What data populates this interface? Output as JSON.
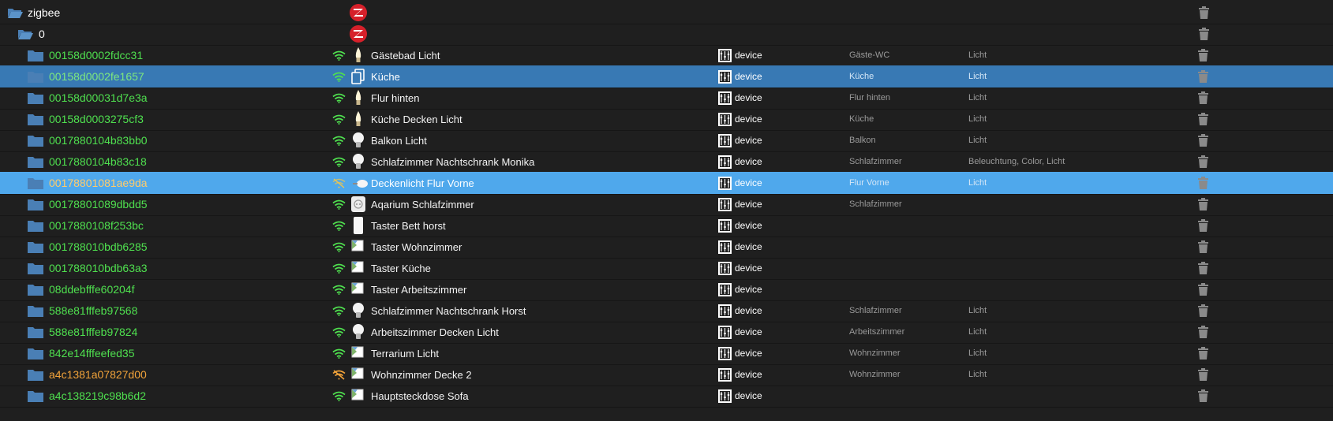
{
  "colors": {
    "background": "#1f1f1f",
    "selected_dark": "#3879b4",
    "selected_light": "#4fa8ec",
    "online": "#4fe04f",
    "offline": "#f2a33a",
    "folder": "#4a7fb5",
    "logo": "#d6202a"
  },
  "root": {
    "label": "zigbee",
    "icon": "zigbee-logo-icon"
  },
  "instance": {
    "label": "0",
    "icon": "zigbee-logo-icon"
  },
  "devices": [
    {
      "id": "00158d0002fdcc31",
      "name": "Gästebad Licht",
      "role": "device",
      "room": "Gäste-WC",
      "function": "Licht",
      "status": "online",
      "icon": "candle-bulb-icon",
      "wifi": "wifi-icon"
    },
    {
      "id": "00158d0002fe1657",
      "name": "Küche",
      "role": "device",
      "room": "Küche",
      "function": "Licht",
      "status": "online",
      "icon": "copy-icon",
      "wifi": "wifi-icon",
      "selected": "dark"
    },
    {
      "id": "00158d00031d7e3a",
      "name": "Flur hinten",
      "role": "device",
      "room": "Flur hinten",
      "function": "Licht",
      "status": "online",
      "icon": "candle-bulb-icon",
      "wifi": "wifi-icon"
    },
    {
      "id": "00158d0003275cf3",
      "name": "Küche Decken Licht",
      "role": "device",
      "room": "Küche",
      "function": "Licht",
      "status": "online",
      "icon": "candle-bulb-icon",
      "wifi": "wifi-icon"
    },
    {
      "id": "0017880104b83bb0",
      "name": "Balkon Licht",
      "role": "device",
      "room": "Balkon",
      "function": "Licht",
      "status": "online",
      "icon": "bulb-icon",
      "wifi": "wifi-icon"
    },
    {
      "id": "0017880104b83c18",
      "name": "Schlafzimmer Nachtschrank Monika",
      "role": "device",
      "room": "Schlafzimmer",
      "function": "Beleuchtung, Color, Licht",
      "status": "online",
      "icon": "bulb-icon",
      "wifi": "wifi-icon"
    },
    {
      "id": "00178801081ae9da",
      "name": "Deckenlicht Flur Vorne",
      "role": "device",
      "room": "Flur Vorne",
      "function": "Licht",
      "status": "offline",
      "icon": "spot-light-icon",
      "wifi": "wifi-weak-icon",
      "selected": "light"
    },
    {
      "id": "00178801089dbdd5",
      "name": "Aqarium Schlafzimmer",
      "role": "device",
      "room": "Schlafzimmer",
      "function": "",
      "status": "online",
      "icon": "smart-plug-icon",
      "wifi": "wifi-icon"
    },
    {
      "id": "0017880108f253bc",
      "name": "Taster Bett horst",
      "role": "device",
      "room": "",
      "function": "",
      "status": "online",
      "icon": "remote-switch-icon",
      "wifi": "wifi-icon"
    },
    {
      "id": "001788010bdb6285",
      "name": "Taster Wohnzimmer",
      "role": "device",
      "room": "",
      "function": "",
      "status": "online",
      "icon": "broken-image-icon",
      "wifi": "wifi-icon"
    },
    {
      "id": "001788010bdb63a3",
      "name": "Taster Küche",
      "role": "device",
      "room": "",
      "function": "",
      "status": "online",
      "icon": "broken-image-icon",
      "wifi": "wifi-icon"
    },
    {
      "id": "08ddebfffe60204f",
      "name": "Taster Arbeitszimmer",
      "role": "device",
      "room": "",
      "function": "",
      "status": "online",
      "icon": "broken-image-icon",
      "wifi": "wifi-icon"
    },
    {
      "id": "588e81fffeb97568",
      "name": "Schlafzimmer Nachtschrank Horst",
      "role": "device",
      "room": "Schlafzimmer",
      "function": "Licht",
      "status": "online",
      "icon": "bulb-icon",
      "wifi": "wifi-icon"
    },
    {
      "id": "588e81fffeb97824",
      "name": "Arbeitszimmer Decken Licht",
      "role": "device",
      "room": "Arbeitszimmer",
      "function": "Licht",
      "status": "online",
      "icon": "bulb-icon",
      "wifi": "wifi-icon"
    },
    {
      "id": "842e14fffeefed35",
      "name": "Terrarium Licht",
      "role": "device",
      "room": "Wohnzimmer",
      "function": "Licht",
      "status": "online",
      "icon": "broken-image-icon",
      "wifi": "wifi-icon"
    },
    {
      "id": "a4c1381a07827d00",
      "name": "Wohnzimmer Decke 2",
      "role": "device",
      "room": "Wohnzimmer",
      "function": "Licht",
      "status": "offline",
      "icon": "broken-image-icon",
      "wifi": "wifi-off-icon"
    },
    {
      "id": "a4c138219c98b6d2",
      "name": "Hauptsteckdose Sofa",
      "role": "device",
      "room": "",
      "function": "",
      "status": "online",
      "icon": "broken-image-icon",
      "wifi": "wifi-icon"
    }
  ]
}
